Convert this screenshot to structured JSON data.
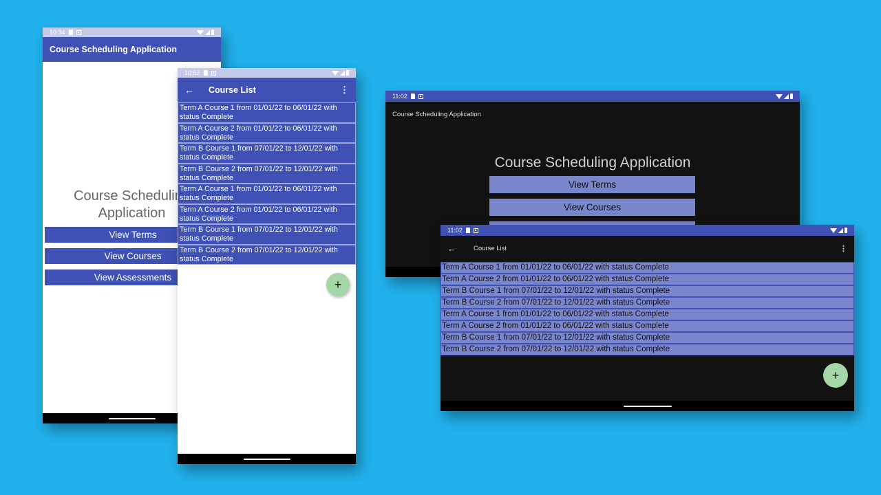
{
  "colors": {
    "background": "#21b1ec",
    "primary": "#3f51b5",
    "primary_light": "#7986cb",
    "status_bar_light": "#c5cae9",
    "fab": "#a5d6a7",
    "dark_surface": "#121212"
  },
  "phone_home": {
    "status_time": "10:34",
    "app_title": "Course Scheduling Application",
    "heading": "Course Scheduling Application",
    "buttons": [
      {
        "label": "View Terms"
      },
      {
        "label": "View Courses"
      },
      {
        "label": "View Assessments"
      }
    ]
  },
  "phone_courses": {
    "status_time": "10:52",
    "back_icon": "←",
    "title": "Course List",
    "menu_icon": "⋮",
    "fab_icon": "+",
    "items": [
      "Term A Course 1 from 01/01/22 to 06/01/22 with status Complete",
      "Term A Course 2 from 01/01/22 to 06/01/22 with status Complete",
      "Term B Course 1 from 07/01/22 to 12/01/22 with status Complete",
      "Term B Course 2 from 07/01/22 to 12/01/22 with status Complete",
      "Term A Course 1 from 01/01/22 to 06/01/22 with status Complete",
      "Term A Course 2 from 01/01/22 to 06/01/22 with status Complete",
      "Term B Course 1 from 07/01/22 to 12/01/22 with status Complete",
      "Term B Course 2 from 07/01/22 to 12/01/22 with status Complete"
    ]
  },
  "tablet_home": {
    "status_time": "11:02",
    "app_title": "Course Scheduling Application",
    "heading": "Course Scheduling Application",
    "buttons": [
      {
        "label": "View Terms"
      },
      {
        "label": "View Courses"
      },
      {
        "label": ""
      }
    ]
  },
  "tablet_courses": {
    "status_time": "11:02",
    "back_icon": "←",
    "title": "Course List",
    "menu_icon": "⋮",
    "fab_icon": "+",
    "items": [
      "Term A Course 1 from 01/01/22 to 06/01/22 with status Complete",
      "Term A Course 2 from 01/01/22 to 06/01/22 with status Complete",
      "Term B Course 1 from 07/01/22 to 12/01/22 with status Complete",
      "Term B Course 2 from 07/01/22 to 12/01/22 with status Complete",
      "Term A Course 1 from 01/01/22 to 06/01/22 with status Complete",
      "Term A Course 2 from 01/01/22 to 06/01/22 with status Complete",
      "Term B Course 1 from 07/01/22 to 12/01/22 with status Complete",
      "Term B Course 2 from 07/01/22 to 12/01/22 with status Complete"
    ]
  }
}
